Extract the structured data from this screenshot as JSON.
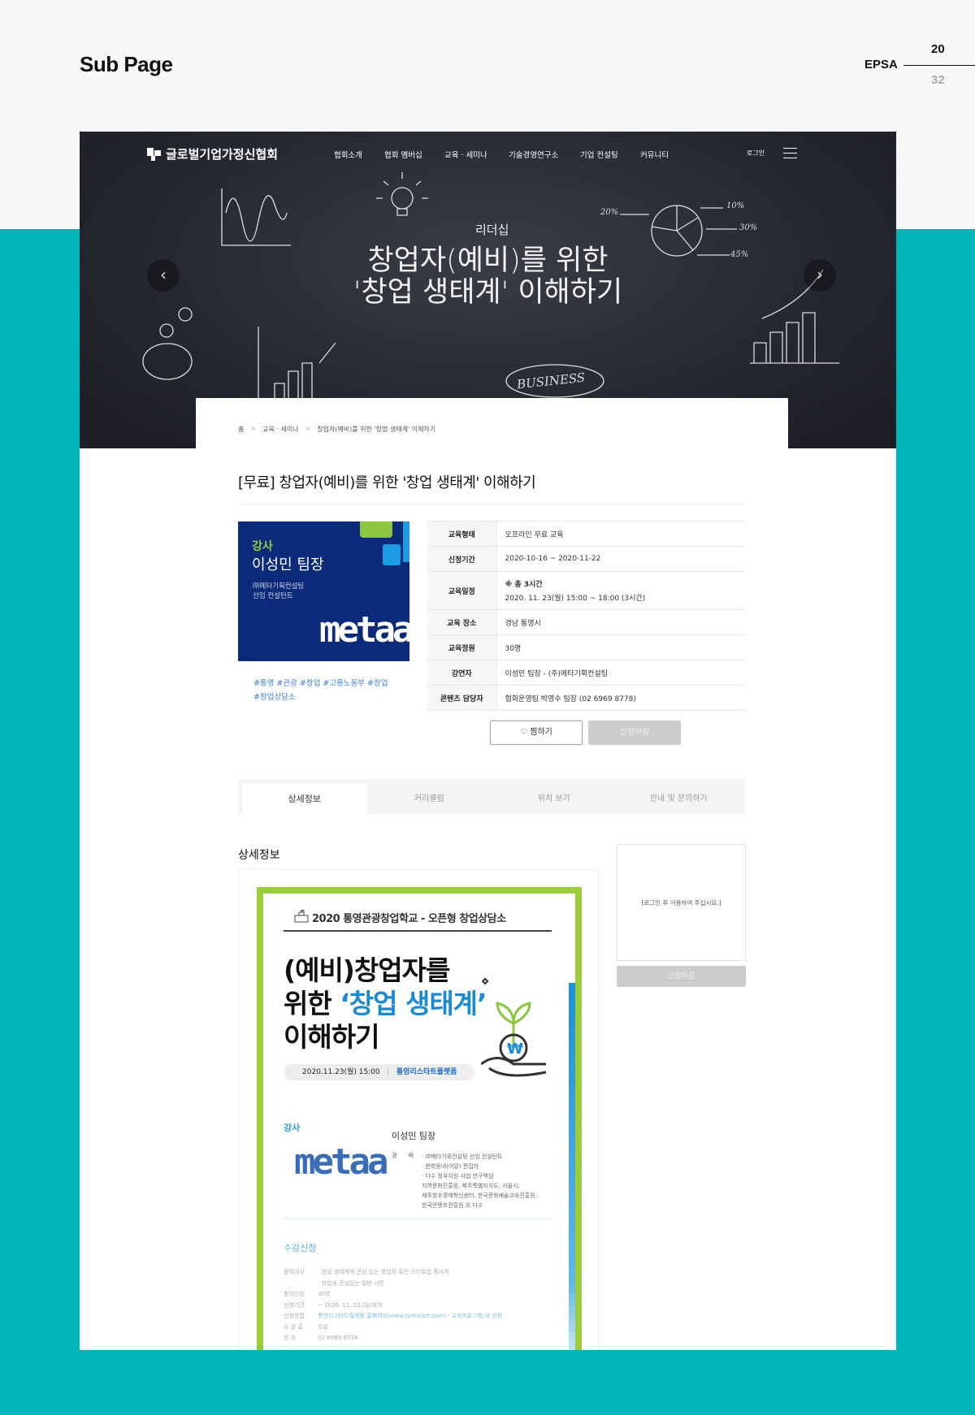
{
  "page": {
    "title": "Sub Page",
    "brand": "EPSA",
    "current_page": "20",
    "total_pages": "32"
  },
  "site": {
    "logo_text": "글로벌기업가정신협회",
    "nav": [
      "협회소개",
      "협회 멤버십",
      "교육 · 세미나",
      "기술경영연구소",
      "기업 컨설팅",
      "커뮤니티"
    ],
    "login": "로그인"
  },
  "hero": {
    "category": "리더십",
    "title_line1": "창업자(예비)를 위한",
    "title_line2": "'창업 생태계' 이해하기",
    "chalk_labels": [
      "20%",
      "10%",
      "30%",
      "45%",
      "BUSINESS"
    ]
  },
  "breadcrumb": [
    "홈",
    "교육 · 세미나",
    "창업자(예비)를 위한 '창업 생태계' 이해하기"
  ],
  "course": {
    "title": "[무료] 창업자(예비)를 위한 '창업 생태계' 이해하기",
    "instructor_card": {
      "label": "강사",
      "name": "이성민 팀장",
      "company": "㈜메타기획컨설팅",
      "role": "선임 컨설턴트",
      "logo": "metaa"
    },
    "tags": "#통영 #관광 #창업 #고용노동부 #창업 #창업상담소",
    "info": [
      {
        "label": "교육형태",
        "value": "오프라인 무료 교육"
      },
      {
        "label": "신청기간",
        "value": "2020-10-16 ~ 2020-11-22"
      },
      {
        "label": "교육일정",
        "value": "※ 총 3시간",
        "value2": "2020. 11. 23(월) 15:00 ~ 18:00 (3시간)"
      },
      {
        "label": "교육 장소",
        "value": "경남 통영시"
      },
      {
        "label": "교육정원",
        "value": "30명"
      },
      {
        "label": "강연자",
        "value": "이성민 팀장 - (주)메타기획컨설팅"
      },
      {
        "label": "콘텐츠 담당자",
        "value": "협회운영팀 박영수 팀장 (02 6969 8778)"
      }
    ],
    "like_button": "♡ 찜하기",
    "closed_button": "신청마감"
  },
  "tabs": [
    {
      "label": "상세정보",
      "active": true
    },
    {
      "label": "커리큘럼",
      "active": false
    },
    {
      "label": "위치 보기",
      "active": false
    },
    {
      "label": "안내 및 문의하기",
      "active": false
    }
  ],
  "detail": {
    "heading": "상세정보",
    "poster": {
      "header": "2020 통영관광창업학교 - 오픈형 창업상담소",
      "title_a": "(예비)창업자를",
      "title_b": "위한 ",
      "title_hl": "‘창업 생태계’",
      "title_c": "이해하기",
      "date": "2020.11.23(월) 15:00",
      "sep": "|",
      "venue": "통영리스타트플랫폼",
      "instructor_label": "강사",
      "instructor_name": "이성민 팀장",
      "logo": "metaa",
      "career_label": "경 력",
      "career": [
        "· ㈜메타기획컨설팅 선임 컨설턴트",
        "· 문학동네(어뮤) 편집자",
        "· 다수 정부지원 사업 연구책임",
        "  지역문화진흥원, 제주특별자치도, 서울시,",
        "  제주창조경제혁신센터, 한국문화예술교육진흥원,",
        "  한국콘텐츠진흥원 외 다수"
      ],
      "apply_heading": "수강신청",
      "apply_rows": [
        {
          "label": "참여대상",
          "value": "· 창업 생태계에 관심 있는 창업자 혹은 스타트업 종사자"
        },
        {
          "label": "",
          "value": "· 창업에 관심있는 일반 시민"
        },
        {
          "label": "참여인원",
          "value": "30명"
        },
        {
          "label": "신청기간",
          "value": "~ 2020. 11. 22.(일)까지"
        },
        {
          "label": "신청방법",
          "value": "통영리스타트플랫폼 홈페이지(www.tyrestart.com) - 교육프로그램 내 신청"
        },
        {
          "label": "수 강 료",
          "value": "무료"
        },
        {
          "label": "문 의",
          "value": "02-6969-8734"
        }
      ]
    },
    "side_notice": "[로그인 후 이용하여 주십시요.]",
    "side_button": "신청마감"
  },
  "colors": {
    "teal": "#00b5b8",
    "accent_blue": "#1a73d9",
    "green": "#9ccb3b",
    "navy": "#0c2a7a"
  }
}
